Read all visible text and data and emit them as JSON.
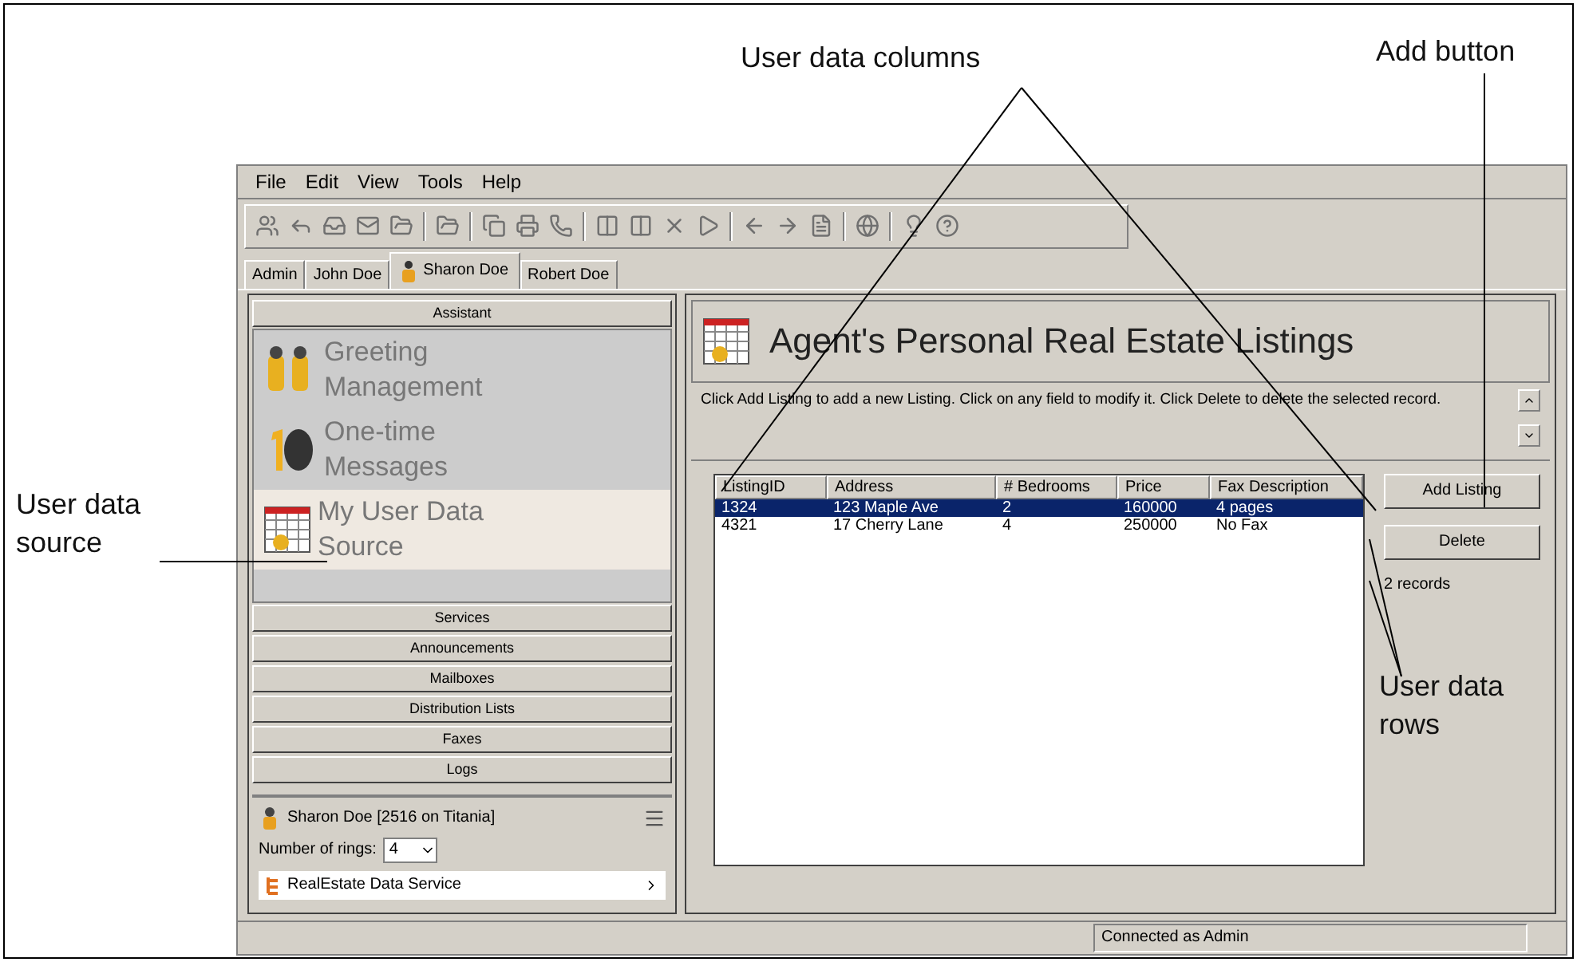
{
  "callouts": [
    {
      "kind": "columns",
      "text": "User data columns"
    },
    {
      "kind": "add",
      "text": "Add button"
    },
    {
      "kind": "source",
      "text": "User data source"
    },
    {
      "kind": "rows",
      "text": "User data rows"
    }
  ],
  "menu": [
    "File",
    "Edit",
    "View",
    "Tools",
    "Help"
  ],
  "tabs": [
    {
      "label": "Admin",
      "selected": false
    },
    {
      "label": "John Doe",
      "selected": false
    },
    {
      "label": "Sharon Doe",
      "selected": true
    },
    {
      "label": "Robert Doe",
      "selected": false
    }
  ],
  "sidebar": {
    "header": "Assistant",
    "items": [
      {
        "label": "Greeting Management",
        "kind": "greeting",
        "selected": false
      },
      {
        "label": "One-time Messages",
        "kind": "message",
        "selected": false
      },
      {
        "label": "My User Data Source",
        "kind": "data",
        "selected": true
      }
    ],
    "sections": [
      "Services",
      "Announcements",
      "Mailboxes",
      "Distribution Lists",
      "Faxes",
      "Logs"
    ],
    "user": "Sharon Doe [2516 on Titania]",
    "rings_label": "Number of rings:",
    "rings_value": "4",
    "service": "RealEstate Data Service"
  },
  "main": {
    "title": "Agent's Personal Real Estate Listings",
    "description": "Click Add Listing to add a new Listing. Click on any field to modify it. Click Delete to delete the selected record.",
    "table": {
      "columns": [
        "ListingID",
        "Address",
        "# Bedrooms",
        "Price",
        "Fax Description"
      ],
      "rows": [
        {
          "cells": [
            "1324",
            "123 Maple Ave",
            "2",
            "160000",
            "4 pages"
          ],
          "selected": true
        },
        {
          "cells": [
            "4321",
            "17 Cherry Lane",
            "4",
            "250000",
            "No Fax"
          ],
          "selected": false
        }
      ]
    },
    "buttons": [
      "Add Listing",
      "Delete"
    ],
    "record_count": "2 records"
  },
  "status_bar": "Connected as Admin"
}
